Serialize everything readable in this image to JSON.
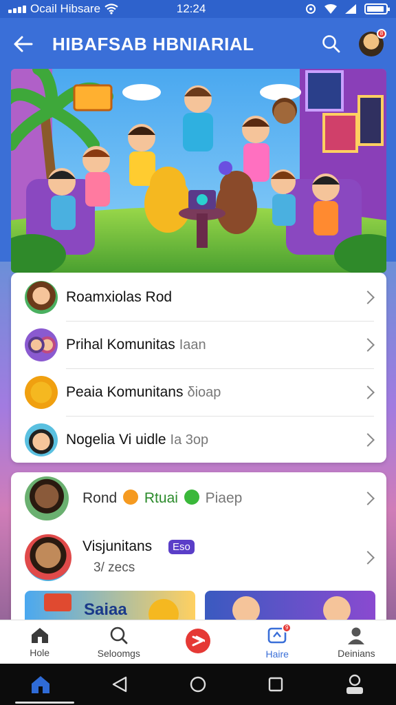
{
  "status_bar": {
    "carrier": "Ocail Hibsare",
    "time": "12:24"
  },
  "app_bar": {
    "title": "HIBAFSAB HBNIARIAL",
    "avatar_badge": "8"
  },
  "list_one": [
    {
      "label": "Roamxiolas Rod",
      "sub": ""
    },
    {
      "label": "Prihal Komunitas",
      "sub": "Iaan"
    },
    {
      "label": "Peaia Komunitans",
      "sub": "δioap"
    },
    {
      "label": "Nogelia Vi uidle",
      "sub": "Ia 3op"
    }
  ],
  "list_two": {
    "row1": {
      "part1": "Rond",
      "part2": "Rtuai",
      "part3": "Piaep"
    },
    "row2": {
      "label": "Visjunitans",
      "chip": "Eso",
      "sub": "3/ zecs"
    }
  },
  "thumbs": {
    "left_text": "Saiaa"
  },
  "tabs": [
    {
      "label": "Hole",
      "icon": "home-outline-icon"
    },
    {
      "label": "Seloomgs",
      "icon": "search-icon"
    },
    {
      "label": "",
      "icon": "play-icon"
    },
    {
      "label": "Haire",
      "icon": "notification-box-icon",
      "badge": "9"
    },
    {
      "label": "Deinians",
      "icon": "person-icon"
    }
  ],
  "nav_bar": {
    "icons": [
      "home-icon",
      "back-triangle-icon",
      "home-circle-icon",
      "recents-square-icon",
      "account-icon"
    ]
  },
  "colors": {
    "app_bar": "#3a6fd8",
    "accent_red": "#e53935",
    "text_dark": "#111111"
  }
}
